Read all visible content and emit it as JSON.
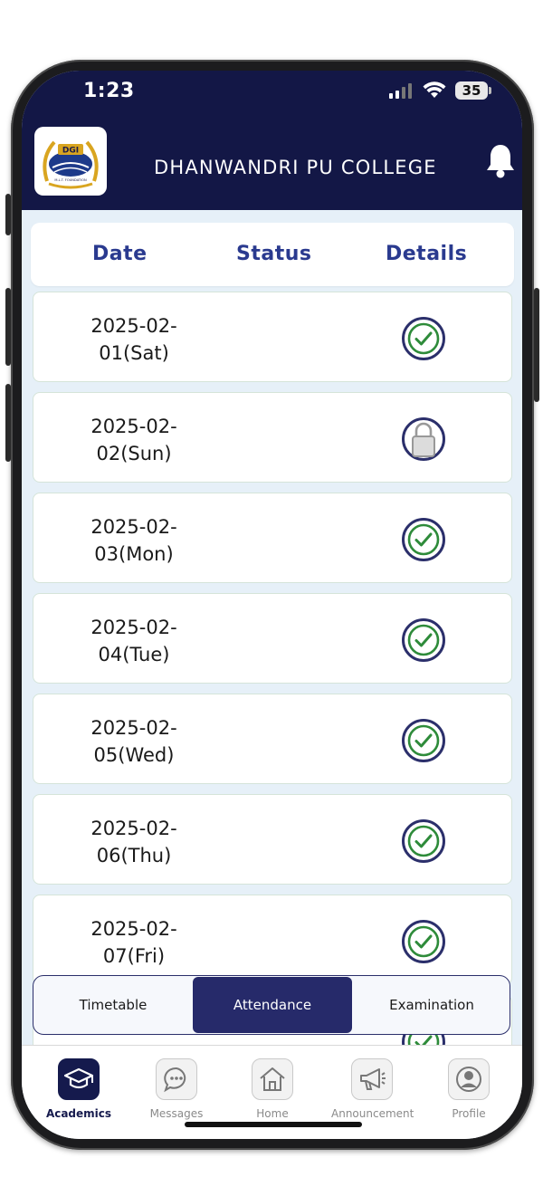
{
  "status": {
    "time": "1:23",
    "battery": "35"
  },
  "header": {
    "title": "DHANWANDRI PU COLLEGE",
    "logo_text": "DGI",
    "logo_sub": "M.L.T. FOUNDATION"
  },
  "table": {
    "columns": [
      "Date",
      "Status",
      "Details"
    ],
    "rows": [
      {
        "date_line1": "2025-02-",
        "date_line2": "01(Sat)",
        "icon": "check-circle-icon"
      },
      {
        "date_line1": "2025-02-",
        "date_line2": "02(Sun)",
        "icon": "lock-icon"
      },
      {
        "date_line1": "2025-02-",
        "date_line2": "03(Mon)",
        "icon": "check-circle-icon"
      },
      {
        "date_line1": "2025-02-",
        "date_line2": "04(Tue)",
        "icon": "check-circle-icon"
      },
      {
        "date_line1": "2025-02-",
        "date_line2": "05(Wed)",
        "icon": "check-circle-icon"
      },
      {
        "date_line1": "2025-02-",
        "date_line2": "06(Thu)",
        "icon": "check-circle-icon"
      },
      {
        "date_line1": "2025-02-",
        "date_line2": "07(Fri)",
        "icon": "check-circle-icon"
      }
    ]
  },
  "tabs": {
    "items": [
      "Timetable",
      "Attendance",
      "Examination"
    ],
    "active": "Attendance"
  },
  "bottom_nav": {
    "items": [
      {
        "label": "Academics",
        "icon": "graduation-cap-icon",
        "active": true
      },
      {
        "label": "Messages",
        "icon": "chat-bubble-icon",
        "active": false
      },
      {
        "label": "Home",
        "icon": "home-icon",
        "active": false
      },
      {
        "label": "Announcement",
        "icon": "megaphone-icon",
        "active": false
      },
      {
        "label": "Profile",
        "icon": "user-icon",
        "active": false
      }
    ]
  },
  "colors": {
    "navy": "#131746",
    "accent": "#2a3a8f",
    "check_green": "#2e8b3a"
  }
}
